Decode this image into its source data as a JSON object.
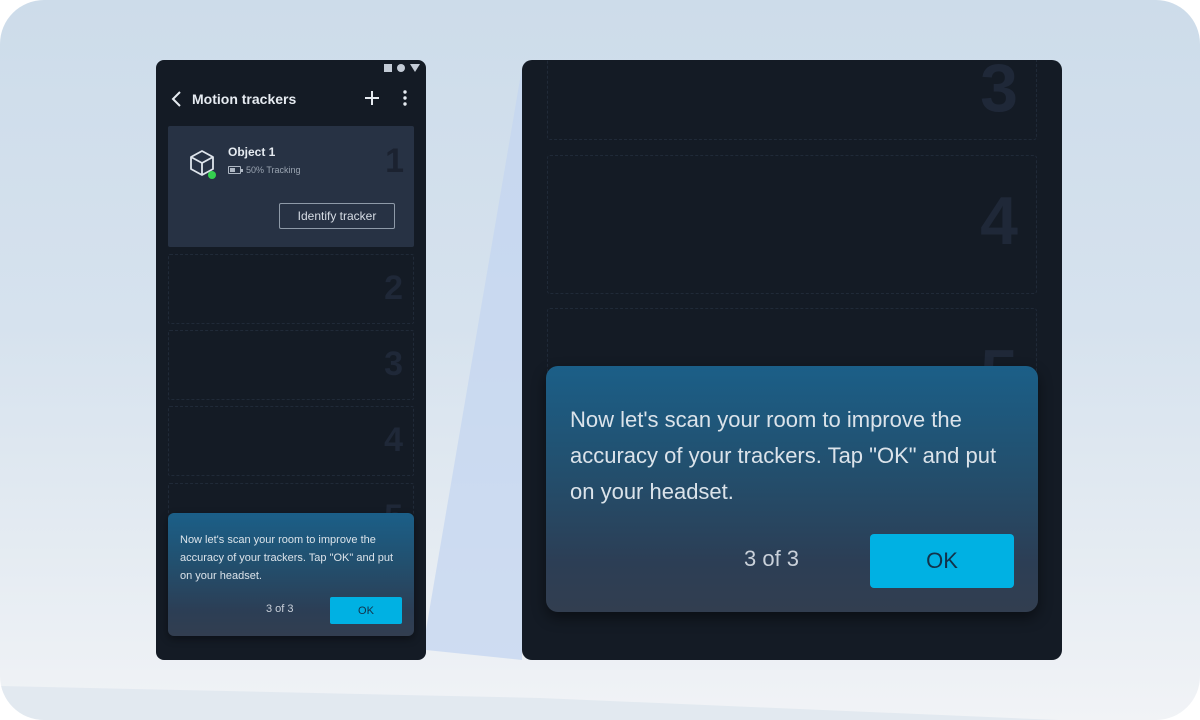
{
  "app_bar": {
    "title": "Motion trackers",
    "back_icon": "chevron-left-icon",
    "add_icon": "plus-icon",
    "more_icon": "more-vertical-icon"
  },
  "status_bar": {
    "icons": [
      "square-icon",
      "circle-icon",
      "triangle-icon"
    ]
  },
  "trackers": [
    {
      "slot": "1",
      "name": "Object 1",
      "icon": "cube-icon",
      "connected": true,
      "battery_percent": 50,
      "status_text": "50% Tracking",
      "action_label": "Identify tracker"
    },
    {
      "slot": "2"
    },
    {
      "slot": "3"
    },
    {
      "slot": "4"
    },
    {
      "slot": "5"
    }
  ],
  "tooltip": {
    "message": "Now let's scan your room to improve the accuracy of your trackers. Tap \"OK\" and put on your headset.",
    "step_text": "3 of 3",
    "step_current": 3,
    "step_total": 3,
    "ok_label": "OK"
  },
  "zoom_view": {
    "visible_slots": [
      "3",
      "4",
      "5"
    ]
  },
  "colors": {
    "accent": "#00b1e3",
    "connected_dot": "#35d04f",
    "background_dark": "#141b25",
    "card_active": "#273244"
  }
}
